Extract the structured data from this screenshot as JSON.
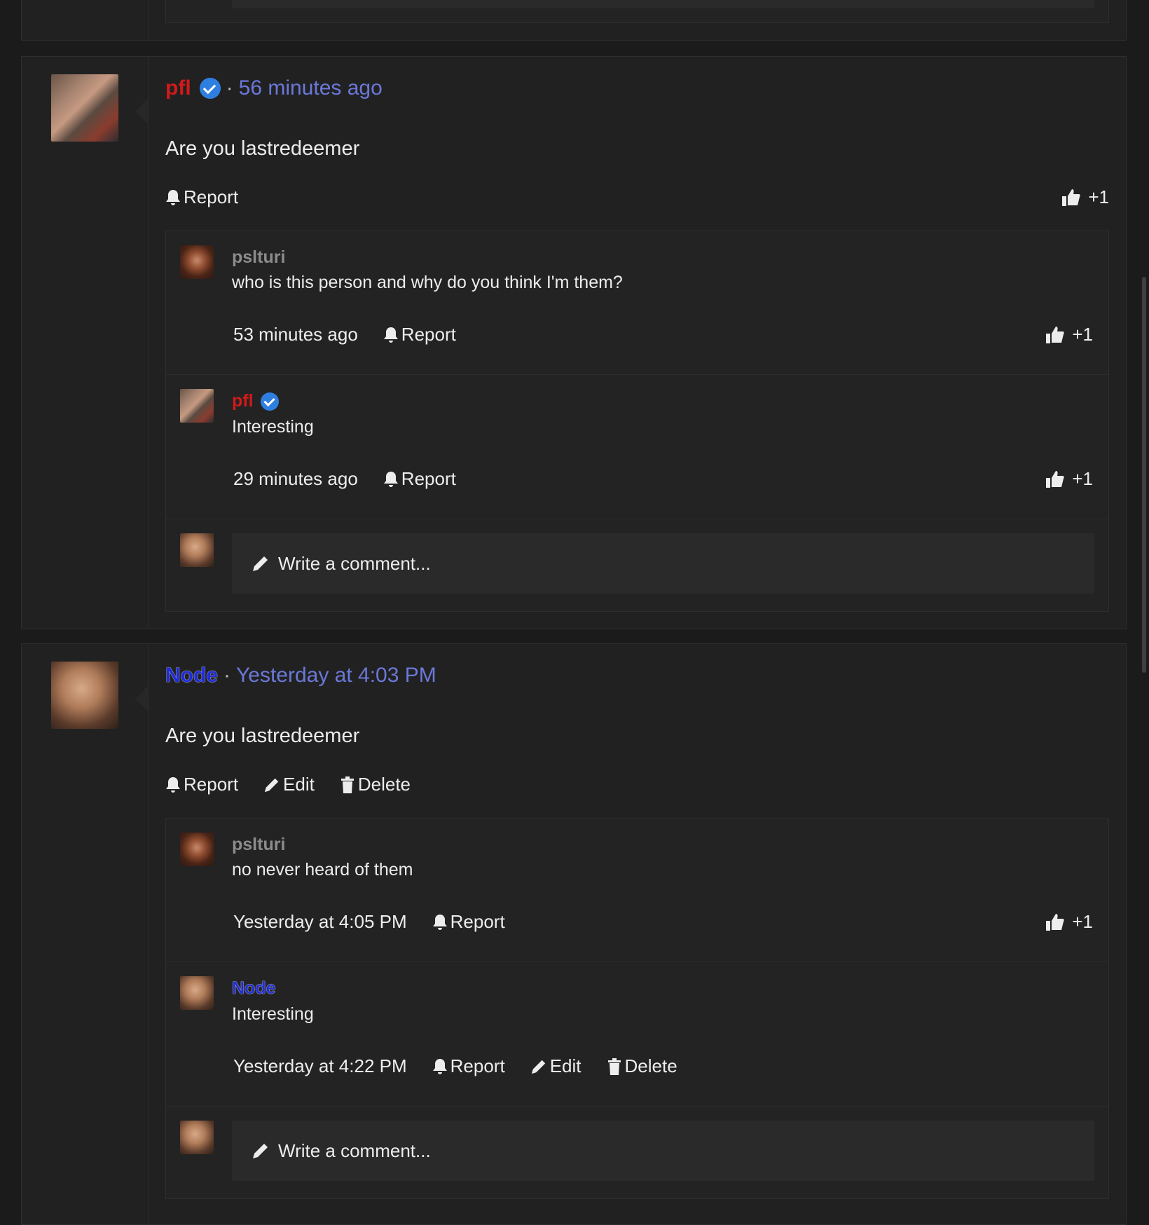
{
  "colors": {
    "accent_blue": "#6b78d9",
    "username_red": "#d11a1a",
    "username_blue": "#1f2bd8",
    "verified": "#2f7fe0"
  },
  "icons": {
    "report": "bell-icon",
    "edit": "pencil-icon",
    "delete": "trash-icon",
    "like": "thumbs-up-icon",
    "write": "pencil-icon",
    "verified": "verified-badge-icon"
  },
  "post1": {
    "username": "pfl",
    "time": "56 minutes ago",
    "text": "Are you lastredeemer",
    "report_label": "Report",
    "like_count": "+1",
    "replies": [
      {
        "username": "pslturi",
        "text": "who is this person and why do you think I'm them?",
        "time": "53 minutes ago",
        "report_label": "Report",
        "like_count": "+1"
      },
      {
        "username": "pfl",
        "text": "Interesting",
        "time": "29 minutes ago",
        "report_label": "Report",
        "like_count": "+1"
      }
    ],
    "write_placeholder": "Write a comment..."
  },
  "post2": {
    "username": "Node",
    "time": "Yesterday at 4:03 PM",
    "text": "Are you lastredeemer",
    "report_label": "Report",
    "edit_label": "Edit",
    "delete_label": "Delete",
    "replies": [
      {
        "username": "pslturi",
        "text": "no never heard of them",
        "time": "Yesterday at 4:05 PM",
        "report_label": "Report",
        "like_count": "+1"
      },
      {
        "username": "Node",
        "text": "Interesting",
        "time": "Yesterday at 4:22 PM",
        "report_label": "Report",
        "edit_label": "Edit",
        "delete_label": "Delete"
      }
    ],
    "write_placeholder": "Write a comment..."
  }
}
